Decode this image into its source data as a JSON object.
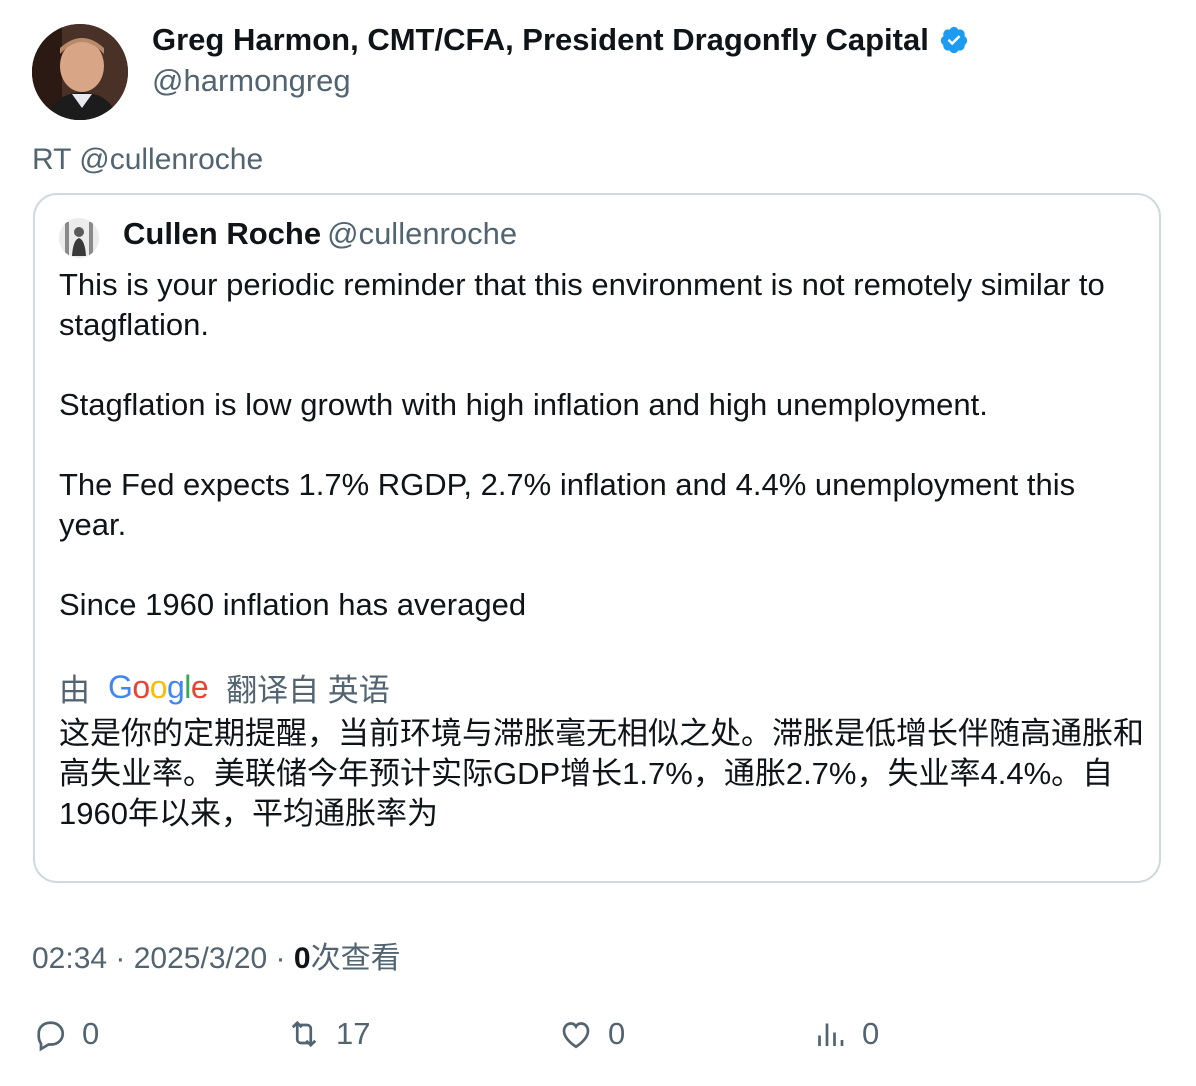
{
  "author": {
    "name": "Greg Harmon, CMT/CFA, President Dragonfly Capital",
    "handle": "@harmongreg",
    "verified_color": "#1d9bf0"
  },
  "retweet_label": "RT @cullenroche",
  "quoted": {
    "name": "Cullen Roche",
    "handle": "@cullenroche",
    "text": "This is your periodic reminder that this environment is not remotely similar to stagflation.\n\nStagflation is low growth with high inflation and high unemployment.\n\nThe Fed expects 1.7% RGDP, 2.7% inflation and 4.4% unemployment this year.\n\nSince 1960 inflation has averaged"
  },
  "translation": {
    "prefix": "由",
    "provider": "Google",
    "suffix": "翻译自 英语",
    "text": "这是你的定期提醒，当前环境与滞胀毫无相似之处。滞胀是低增长伴随高通胀和高失业率。美联储今年预计实际GDP增长1.7%，通胀2.7%，失业率4.4%。自1960年以来，平均通胀率为"
  },
  "meta": {
    "time": "02:34",
    "date": "2025/3/20",
    "views_count": "0",
    "views_label": "次查看"
  },
  "actions": {
    "replies": "0",
    "retweets": "17",
    "likes": "0",
    "views": "0"
  }
}
